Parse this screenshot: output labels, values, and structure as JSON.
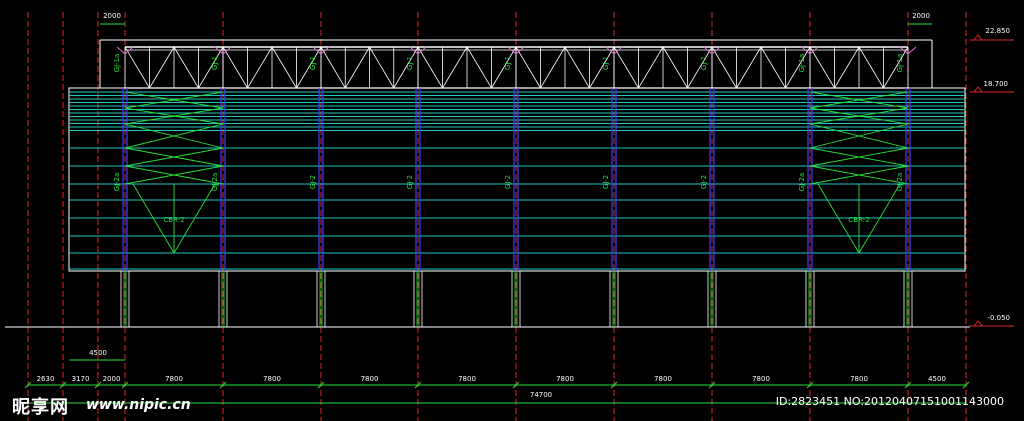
{
  "dims": {
    "top_left": "2000",
    "top_right": "2000",
    "left_4500": "4500",
    "bays": [
      "2630",
      "3170",
      "2000",
      "7800",
      "7800",
      "7800",
      "7800",
      "7800",
      "7800",
      "7800",
      "7800",
      "4500"
    ],
    "total": "74700"
  },
  "elevations": [
    "22.850",
    "18.700",
    "-0.050"
  ],
  "truss_labels": [
    "GJ-1a",
    "GJ-1",
    "GJ-1",
    "GJ-1",
    "GJ-1",
    "GJ-1",
    "GJ-1",
    "GJ-1a",
    "GJ-1a"
  ],
  "column_labels": [
    "GJ-2a",
    "GJ-2a",
    "GJ-2",
    "GJ-2",
    "GJ-2",
    "GJ-2",
    "GJ-2",
    "GJ-2a",
    "GJ-2a"
  ],
  "bracing_labels": [
    "CBR-2",
    "CBR-2"
  ],
  "watermark": {
    "logo": "昵享网",
    "url": "www.nipic.cn",
    "id": "ID:2823451 NO:20120407151001143000"
  },
  "colors": {
    "background": "#000000",
    "grid_red": "#e0262a",
    "truss": "#ffffff",
    "cladding": "#21c9c1",
    "column_blue": "#4040ff",
    "bracing": "#26e03a",
    "dimension": "#26e03a",
    "text": "#ffffff"
  }
}
